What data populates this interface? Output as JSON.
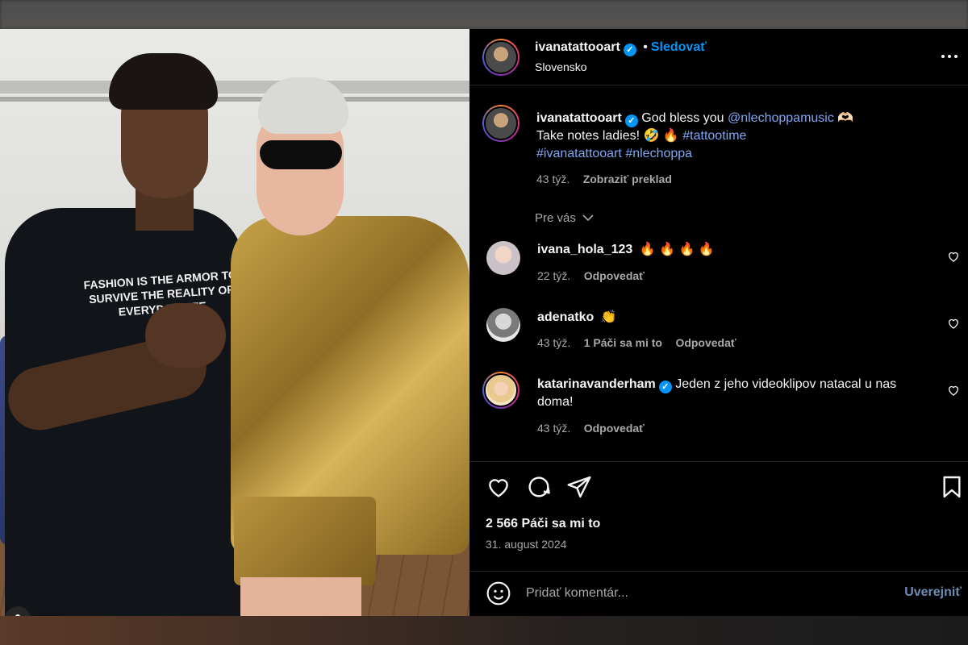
{
  "post": {
    "author": "ivanatattooart",
    "follow_label": "Sledovať",
    "dot": "•",
    "location": "Slovensko",
    "more_icon": "more-horizontal-icon",
    "shirt_text": "FASHION IS THE ARMOR TO SURVIVE THE REALITY OF EVERYDAY LIFE"
  },
  "caption": {
    "author": "ivanatattooart",
    "text_1": "God bless you",
    "mention": "@nlechoppamusic",
    "emoji_1": "🫶🏻",
    "line_2": "Take notes ladies! 🤣 🔥",
    "hashtag_1": "#tattootime",
    "hashtag_2": "#ivanatattooart",
    "hashtag_3": "#nlechoppa",
    "time": "43 týž.",
    "translate": "Zobraziť preklad"
  },
  "filter": {
    "label": "Pre vás"
  },
  "comments": [
    {
      "user": "ivana_hola_123",
      "text": "🔥 🔥 🔥 🔥",
      "time": "22 týž.",
      "likes": "",
      "reply": "Odpovedať"
    },
    {
      "user": "adenatko",
      "text": "👏",
      "time": "43 týž.",
      "likes": "1 Páči sa mi to",
      "reply": "Odpovedať"
    },
    {
      "user": "katarinavanderham",
      "text": "Jeden z jeho videoklipov natacal u nas doma!",
      "time": "43 týž.",
      "likes": "",
      "reply": "Odpovedať"
    }
  ],
  "stats": {
    "likes": "2 566 Páči sa mi to",
    "date": "31. august 2024"
  },
  "composer": {
    "placeholder": "Pridať komentár...",
    "post_label": "Uverejniť"
  },
  "colors": {
    "accent": "#0095f6",
    "background": "#000000",
    "link": "#7fa7f3"
  }
}
